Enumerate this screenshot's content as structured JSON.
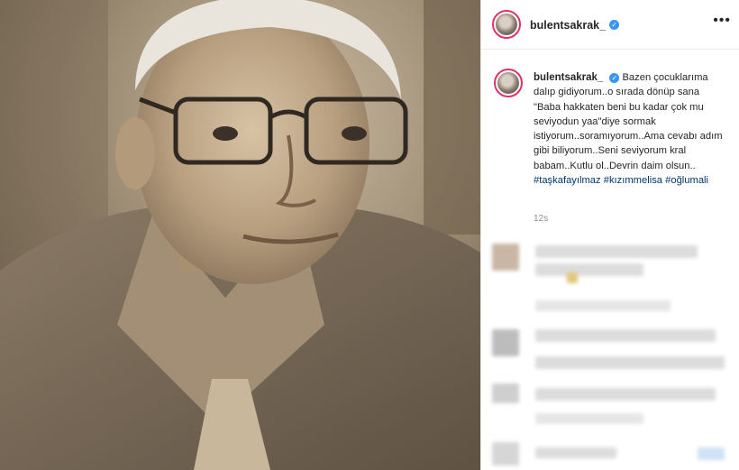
{
  "post": {
    "username": "bulentsakrak_",
    "caption_username": "bulentsakrak_",
    "caption_text": "Bazen çocuklarıma dalıp gidiyorum..o sırada dönüp sana \"Baba hakkaten beni bu kadar çok mu seviyodun yaa\"diye sormak istiyorum..soramıyorum..Ama cevabı adım gibi biliyorum..Seni seviyorum kral babam..Kutlu ol..Devrin daim olsun..",
    "hashtags": [
      "#taşkafayılmaz",
      "#kızımmelisa",
      "#oğlumali"
    ],
    "timestamp": "12s",
    "more_icon": "•••",
    "verified_icon": "✓"
  },
  "colors": {
    "verified_blue": "#3897f0",
    "hashtag_blue": "#00376b",
    "photo_tone": "#8a7a65"
  }
}
